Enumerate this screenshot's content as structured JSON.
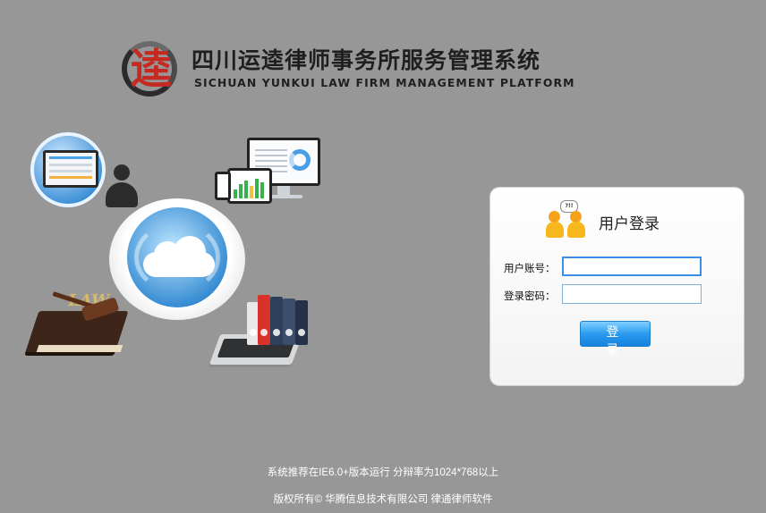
{
  "header": {
    "logo_char": "逵",
    "title": "四川运逵律师事务所服务管理系统",
    "subtitle": "SICHUAN YUNKUI LAW FIRM MANAGEMENT PLATFORM"
  },
  "login": {
    "title": "用户登录",
    "bubble_text": "?!!",
    "username_label": "用户账号：",
    "username_value": "",
    "password_label": "登录密码：",
    "password_value": "",
    "submit_label": "登 录"
  },
  "illustration": {
    "book_text": "LAW"
  },
  "footer": {
    "line1": "系统推荐在IE6.0+版本运行 分辩率为1024*768以上",
    "line2": "版权所有© 华腾信息技术有限公司 律通律师软件"
  },
  "colors": {
    "background": "#979797",
    "accent_blue": "#2a9bf0",
    "logo_red": "#c42a22",
    "user_orange": "#f6b81e"
  }
}
